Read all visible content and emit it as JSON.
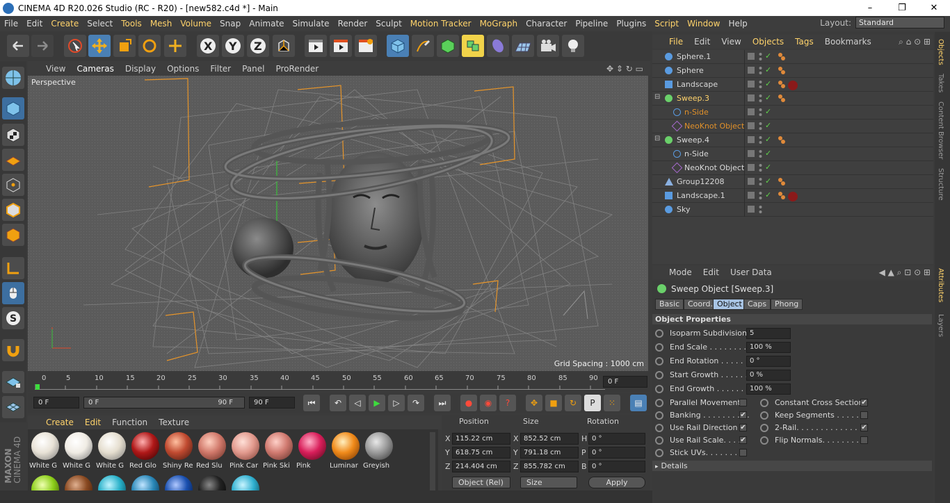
{
  "window": {
    "title": "CINEMA 4D R20.026 Studio (RC - R20) - [new582.c4d *] - Main",
    "controls": [
      "–",
      "❐",
      "✕"
    ]
  },
  "menubar": {
    "items": [
      "File",
      "Edit",
      "Create",
      "Select",
      "Tools",
      "Mesh",
      "Volume",
      "Snap",
      "Animate",
      "Simulate",
      "Render",
      "Sculpt",
      "Motion Tracker",
      "MoGraph",
      "Character",
      "Pipeline",
      "Plugins",
      "Script",
      "Window",
      "Help"
    ],
    "layout_label": "Layout:",
    "layout_value": "Standard"
  },
  "viewport": {
    "menu": [
      "View",
      "Cameras",
      "Display",
      "Options",
      "Filter",
      "Panel",
      "ProRender"
    ],
    "camera_label": "Perspective",
    "grid_spacing": "Grid Spacing : 1000 cm"
  },
  "timeline": {
    "ticks": [
      "0",
      "5",
      "10",
      "15",
      "20",
      "25",
      "30",
      "35",
      "40",
      "45",
      "50",
      "55",
      "60",
      "65",
      "70",
      "75",
      "80",
      "85",
      "90"
    ],
    "current_frame": "0 F"
  },
  "transport": {
    "start": "0 F",
    "range_start": "0 F",
    "range_end": "90 F",
    "end": "90 F"
  },
  "materials": {
    "menu": [
      "Create",
      "Edit",
      "Function",
      "Texture"
    ],
    "items": [
      {
        "label": "White G",
        "color": "#e8e2d6"
      },
      {
        "label": "White G",
        "color": "#f0ece4"
      },
      {
        "label": "White G",
        "color": "#e5decf"
      },
      {
        "label": "Red Glo",
        "color": "#b01818"
      },
      {
        "label": "Shiny Re",
        "color": "#c04a30"
      },
      {
        "label": "Red Slu",
        "color": "#d0786a"
      },
      {
        "label": "Pink Car",
        "color": "#e29a8e"
      },
      {
        "label": "Pink Ski",
        "color": "#d07a70"
      },
      {
        "label": "Pink",
        "color": "#d81e5a"
      },
      {
        "label": "Luminar",
        "color": "#f08a1a"
      },
      {
        "label": "Greyish",
        "color": "#9a9a9a"
      }
    ],
    "row2_colors": [
      "#8ccf1a",
      "#8a4a22",
      "#28b0c8",
      "#2a88b8",
      "#1a50b0",
      "#222222",
      "#30b0d0"
    ]
  },
  "coords": {
    "headers": [
      "Position",
      "Size",
      "Rotation"
    ],
    "rows": [
      {
        "axis": "X",
        "pos": "115.22 cm",
        "saxis": "X",
        "size": "852.52 cm",
        "raxis": "H",
        "rot": "0 °"
      },
      {
        "axis": "Y",
        "pos": "618.75 cm",
        "saxis": "Y",
        "size": "791.18 cm",
        "raxis": "P",
        "rot": "0 °"
      },
      {
        "axis": "Z",
        "pos": "214.404 cm",
        "saxis": "Z",
        "size": "855.782 cm",
        "raxis": "B",
        "rot": "0 °"
      }
    ],
    "mode": "Object (Rel)",
    "size_mode": "Size",
    "apply": "Apply"
  },
  "object_manager": {
    "menu": [
      "File",
      "Edit",
      "View",
      "Objects",
      "Tags",
      "Bookmarks"
    ],
    "objects": [
      {
        "name": "Sphere.1",
        "indent": 0,
        "icon": "#5a9be0",
        "style": "normal"
      },
      {
        "name": "Sphere",
        "indent": 0,
        "icon": "#5a9be0",
        "style": "normal"
      },
      {
        "name": "Landscape",
        "indent": 0,
        "icon": "#5a9be0",
        "style": "normal"
      },
      {
        "name": "Sweep.3",
        "indent": 0,
        "icon": "#6ad06a",
        "style": "hi"
      },
      {
        "name": "n-Side",
        "indent": 1,
        "icon": "#5a9be0",
        "style": "or"
      },
      {
        "name": "NeoKnot Object",
        "indent": 1,
        "icon": "#a86ad0",
        "style": "or"
      },
      {
        "name": "Sweep.4",
        "indent": 0,
        "icon": "#6ad06a",
        "style": "normal"
      },
      {
        "name": "n-Side",
        "indent": 1,
        "icon": "#5a9be0",
        "style": "normal"
      },
      {
        "name": "NeoKnot Object",
        "indent": 1,
        "icon": "#a86ad0",
        "style": "normal"
      },
      {
        "name": "Group12208",
        "indent": 0,
        "icon": "#8ab0e0",
        "style": "normal"
      },
      {
        "name": "Landscape.1",
        "indent": 0,
        "icon": "#5a9be0",
        "style": "normal"
      },
      {
        "name": "Sky",
        "indent": 0,
        "icon": "#5a9be0",
        "style": "normal"
      }
    ]
  },
  "attributes": {
    "menu": [
      "Mode",
      "Edit",
      "User Data"
    ],
    "title": "Sweep Object [Sweep.3]",
    "tabs": [
      "Basic",
      "Coord.",
      "Object",
      "Caps",
      "Phong"
    ],
    "section": "Object Properties",
    "fields": [
      {
        "label": "Isoparm Subdivision",
        "value": "5"
      },
      {
        "label": "End Scale . . . . . . . . .",
        "value": "100 %"
      },
      {
        "label": "End Rotation . . . . . .",
        "value": "0 °"
      },
      {
        "label": "Start Growth . . . . . .",
        "value": "0 %"
      },
      {
        "label": "End Growth . . . . . . .",
        "value": "100 %"
      }
    ],
    "checks_left": [
      {
        "label": "Parallel Movement",
        "checked": ""
      },
      {
        "label": "Banking . . . . . . . . . .",
        "checked": "✔"
      },
      {
        "label": "Use Rail Direction",
        "checked": "✔"
      },
      {
        "label": "Use Rail Scale. . . .",
        "checked": "✔"
      },
      {
        "label": "Stick UVs. . . . . . . .",
        "checked": ""
      }
    ],
    "checks_right": [
      {
        "label": "Constant Cross Section",
        "checked": "✔"
      },
      {
        "label": "Keep Segments . . . . . .",
        "checked": ""
      },
      {
        "label": "2-Rail. . . . . . . . . . . . . .",
        "checked": "✔"
      },
      {
        "label": "Flip Normals. . . . . . . .",
        "checked": ""
      }
    ],
    "details": "Details"
  },
  "side_tabs": [
    "Objects",
    "Takes",
    "Content Browser",
    "Structure",
    "Attributes",
    "Layers"
  ],
  "brand": {
    "line1": "MAXON",
    "line2": "CINEMA 4D"
  }
}
